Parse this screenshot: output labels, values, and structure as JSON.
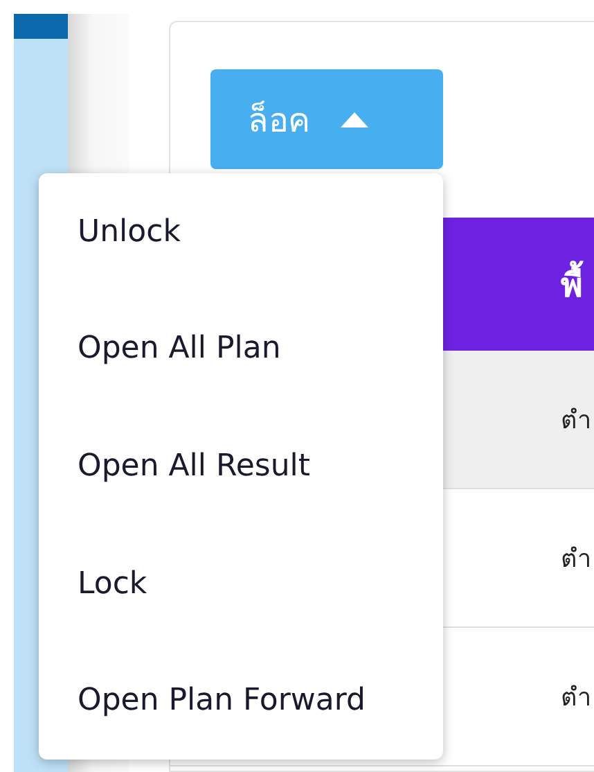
{
  "lock_button": {
    "label": "ล็อค",
    "expanded": true
  },
  "menu": {
    "items": [
      "Unlock",
      "Open All Plan",
      "Open All Result",
      "Lock",
      "Open Plan Forward"
    ]
  },
  "table": {
    "header": "พื้",
    "rows": [
      {
        "cell": "ตำ",
        "shaded": true
      },
      {
        "cell": "ตำ",
        "shaded": false
      },
      {
        "cell": "ตำ",
        "shaded": false
      }
    ]
  }
}
